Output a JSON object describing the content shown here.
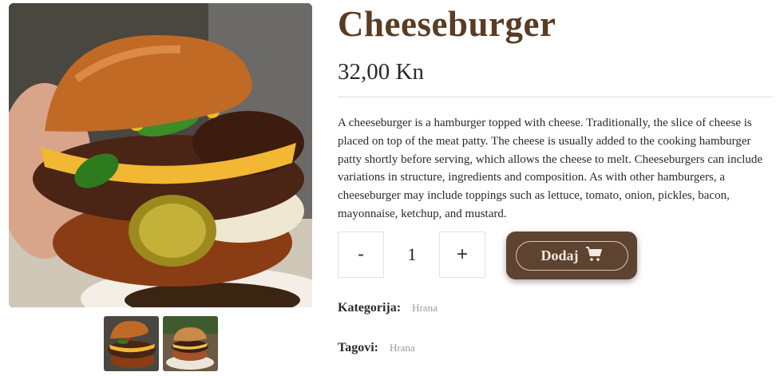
{
  "product": {
    "title": "Cheeseburger",
    "price": "32,00 Kn",
    "description": "A cheeseburger is a hamburger topped with cheese. Traditionally, the slice of cheese is placed on top of the meat patty. The cheese is usually added to the cooking hamburger patty shortly before serving, which allows the cheese to melt. Cheeseburgers can include variations in structure, ingredients and composition. As with other hamburgers, a cheeseburger may include toppings such as lettuce, tomato, onion, pickles, bacon, mayonnaise, ketchup, and mustard."
  },
  "quantity": {
    "decrement_label": "-",
    "value": "1",
    "increment_label": "+"
  },
  "cart_button": {
    "label": "Dodaj",
    "icon": "cart-icon"
  },
  "meta": {
    "category_label": "Kategorija:",
    "category_value": "Hrana",
    "tags_label": "Tagovi:",
    "tags_value": "Hrana"
  },
  "gallery": {
    "thumbnails": [
      "cheeseburger-thumbnail-1",
      "cheeseburger-thumbnail-2"
    ]
  },
  "colors": {
    "brand_brown": "#5a3c24",
    "button_brown": "#5e4330",
    "button_text": "#f3e9df",
    "muted_text": "#9a9a9a"
  }
}
